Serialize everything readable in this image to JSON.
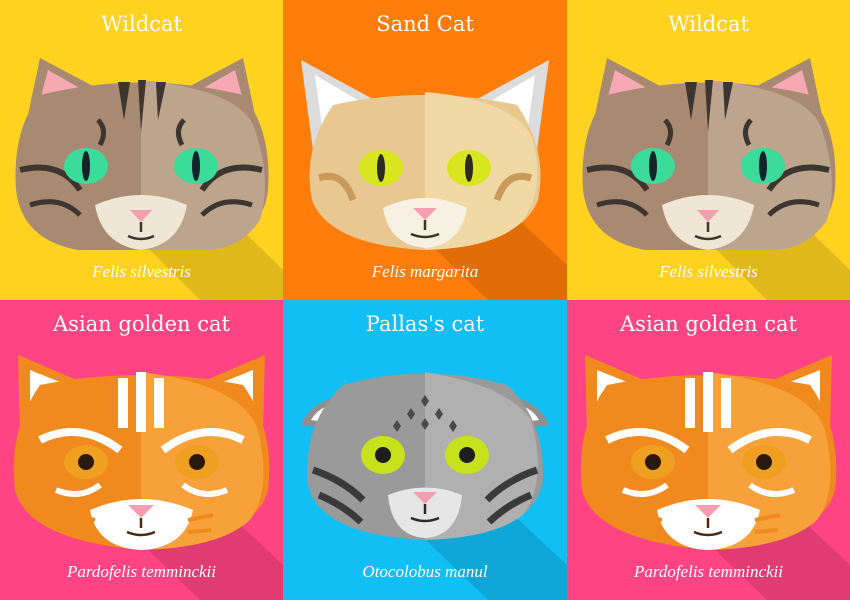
{
  "tiles": [
    {
      "common": "Wildcat",
      "scientific": "Felis silvestris",
      "bg": "#FFD21F",
      "species": "wildcat"
    },
    {
      "common": "Sand Cat",
      "scientific": "Felis margarita",
      "bg": "#FF7D0A",
      "species": "sandcat"
    },
    {
      "common": "Wildcat",
      "scientific": "Felis silvestris",
      "bg": "#FFD21F",
      "species": "wildcat"
    },
    {
      "common": "Asian golden cat",
      "scientific": "Pardofelis temminckii",
      "bg": "#FF4483",
      "species": "goldencat"
    },
    {
      "common": "Pallas's cat",
      "scientific": "Otocolobus manul",
      "bg": "#12BFF5",
      "species": "pallas"
    },
    {
      "common": "Asian golden cat",
      "scientific": "Pardofelis temminckii",
      "bg": "#FF4483",
      "species": "goldencat"
    }
  ]
}
